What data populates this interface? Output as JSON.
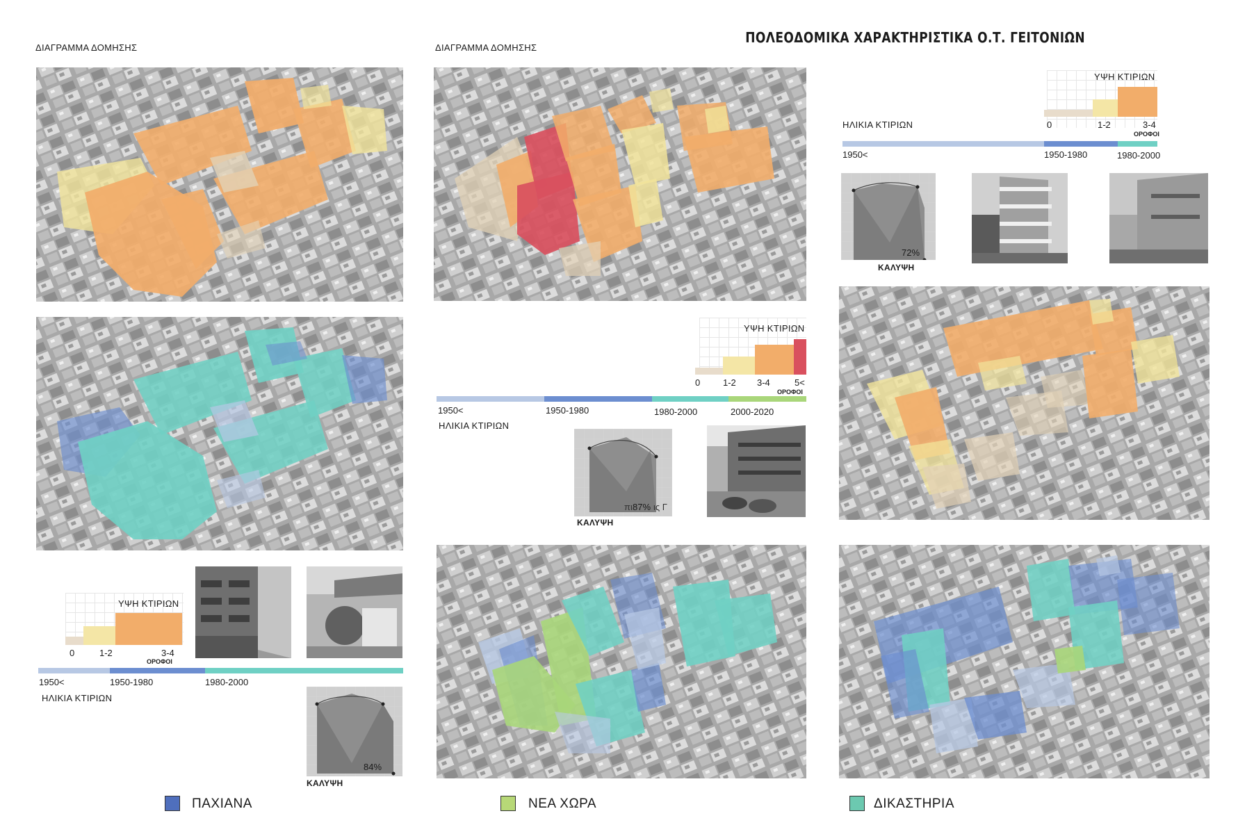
{
  "main_title": "ΠΟΛΕΟΔΟΜΙΚΑ ΧΑΡΑΚΤΗΡΙΣΤΙΚΑ Ο.Τ. ΓΕΙΤΟΝΙΩΝ",
  "colors": {
    "orange": "#f2ad6a",
    "yellow": "#f1e39a",
    "beige": "#e2d2b6",
    "red": "#d9505e",
    "teal": "#6fd0c4",
    "blue": "#6c8ed0",
    "lightblue": "#b7c8e4",
    "green": "#a9d67a"
  },
  "left": {
    "diagram_label": "ΔΙΑΓΡΑΜΜΑ ΔΟΜΗΣΗΣ",
    "heights_title": "ΥΨΗ ΚΤΙΡΙΩΝ",
    "height_ticks": [
      "0",
      "1-2",
      "3-4"
    ],
    "floors_label": "ΟΡΟΦΟΙ",
    "age_ticks": [
      "1950<",
      "1950-1980",
      "1980-2000"
    ],
    "age_label": "ΗΛΙΚΙΑ ΚΤΙΡΙΩΝ",
    "coverage_value": "84%",
    "coverage_label": "ΚΑΛΥΨΗ"
  },
  "middle": {
    "diagram_label": "ΔΙΑΓΡΑΜΜΑ ΔΟΜΗΣΗΣ",
    "heights_title": "ΥΨΗ ΚΤΙΡΙΩΝ",
    "height_ticks": [
      "0",
      "1-2",
      "3-4",
      "5<"
    ],
    "floors_label": "ΟΡΟΦΟΙ",
    "age_ticks": [
      "1950<",
      "1950-1980",
      "1980-2000",
      "2000-2020"
    ],
    "age_label": "ΗΛΙΚΙΑ ΚΤΙΡΙΩΝ",
    "coverage_value": "87%",
    "coverage_overlay": "πι",
    "coverage_overlay2": "ις Γ",
    "coverage_label": "ΚΑΛΥΨΗ"
  },
  "right": {
    "heights_title": "ΥΨΗ ΚΤΙΡΙΩΝ",
    "height_ticks": [
      "0",
      "1-2",
      "3-4"
    ],
    "floors_label": "ΟΡΟΦΟΙ",
    "age_label": "ΗΛΙΚΙΑ ΚΤΙΡΙΩΝ",
    "age_ticks": [
      "1950<",
      "1950-1980",
      "1980-2000"
    ],
    "coverage_value": "72%",
    "coverage_label": "ΚΑΛΥΨΗ"
  },
  "legend": [
    {
      "label": "ΠΑΧΙΑΝΑ",
      "color": "#4f6fbd"
    },
    {
      "label": "ΝΕΑ ΧΩΡΑ",
      "color": "#b7d877"
    },
    {
      "label": "ΔΙΚΑΣΤΗΡΙΑ",
      "color": "#6cc9b0"
    }
  ]
}
